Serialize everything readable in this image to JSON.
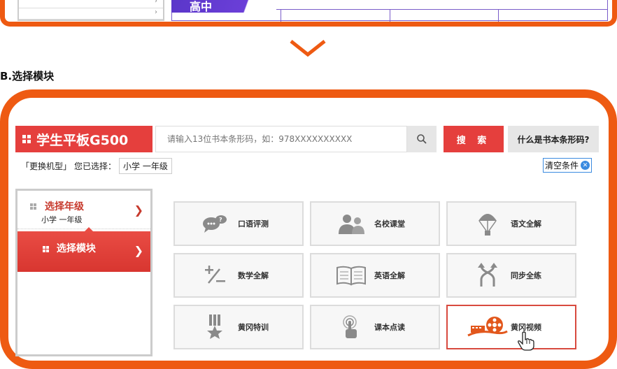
{
  "top_banner": {
    "label": "高中"
  },
  "section_title": "B.选择模块",
  "header": {
    "brand": "学生平板G500",
    "search_placeholder": "请输入13位书本条形码，如：978XXXXXXXXXX",
    "submit_label": "搜 索",
    "help_label": "什么是书本条形码?"
  },
  "selection": {
    "change_model": "「更换机型」",
    "selected_prefix": "您已选择：",
    "selected_value": "小学 一年级",
    "clear_label": "清空条件"
  },
  "side_nav": {
    "grade_title": "选择年级",
    "grade_value": "小学 一年级",
    "module_title": "选择模块"
  },
  "modules": [
    {
      "label": "口语评测",
      "icon": "speech-bubble-icon"
    },
    {
      "label": "名校课堂",
      "icon": "group-people-icon"
    },
    {
      "label": "语文全解",
      "icon": "parachute-icon"
    },
    {
      "label": "数学全解",
      "icon": "plus-minus-icon"
    },
    {
      "label": "英语全解",
      "icon": "open-book-icon"
    },
    {
      "label": "同步全练",
      "icon": "cross-arrows-icon"
    },
    {
      "label": "黄冈特训",
      "icon": "medal-star-icon"
    },
    {
      "label": "课本点读",
      "icon": "touch-point-icon"
    },
    {
      "label": "黄冈视频",
      "icon": "film-reel-icon"
    }
  ],
  "colors": {
    "accent": "#ee5a12",
    "brand_red": "#e53f3d",
    "active_border": "#d84a3f"
  }
}
